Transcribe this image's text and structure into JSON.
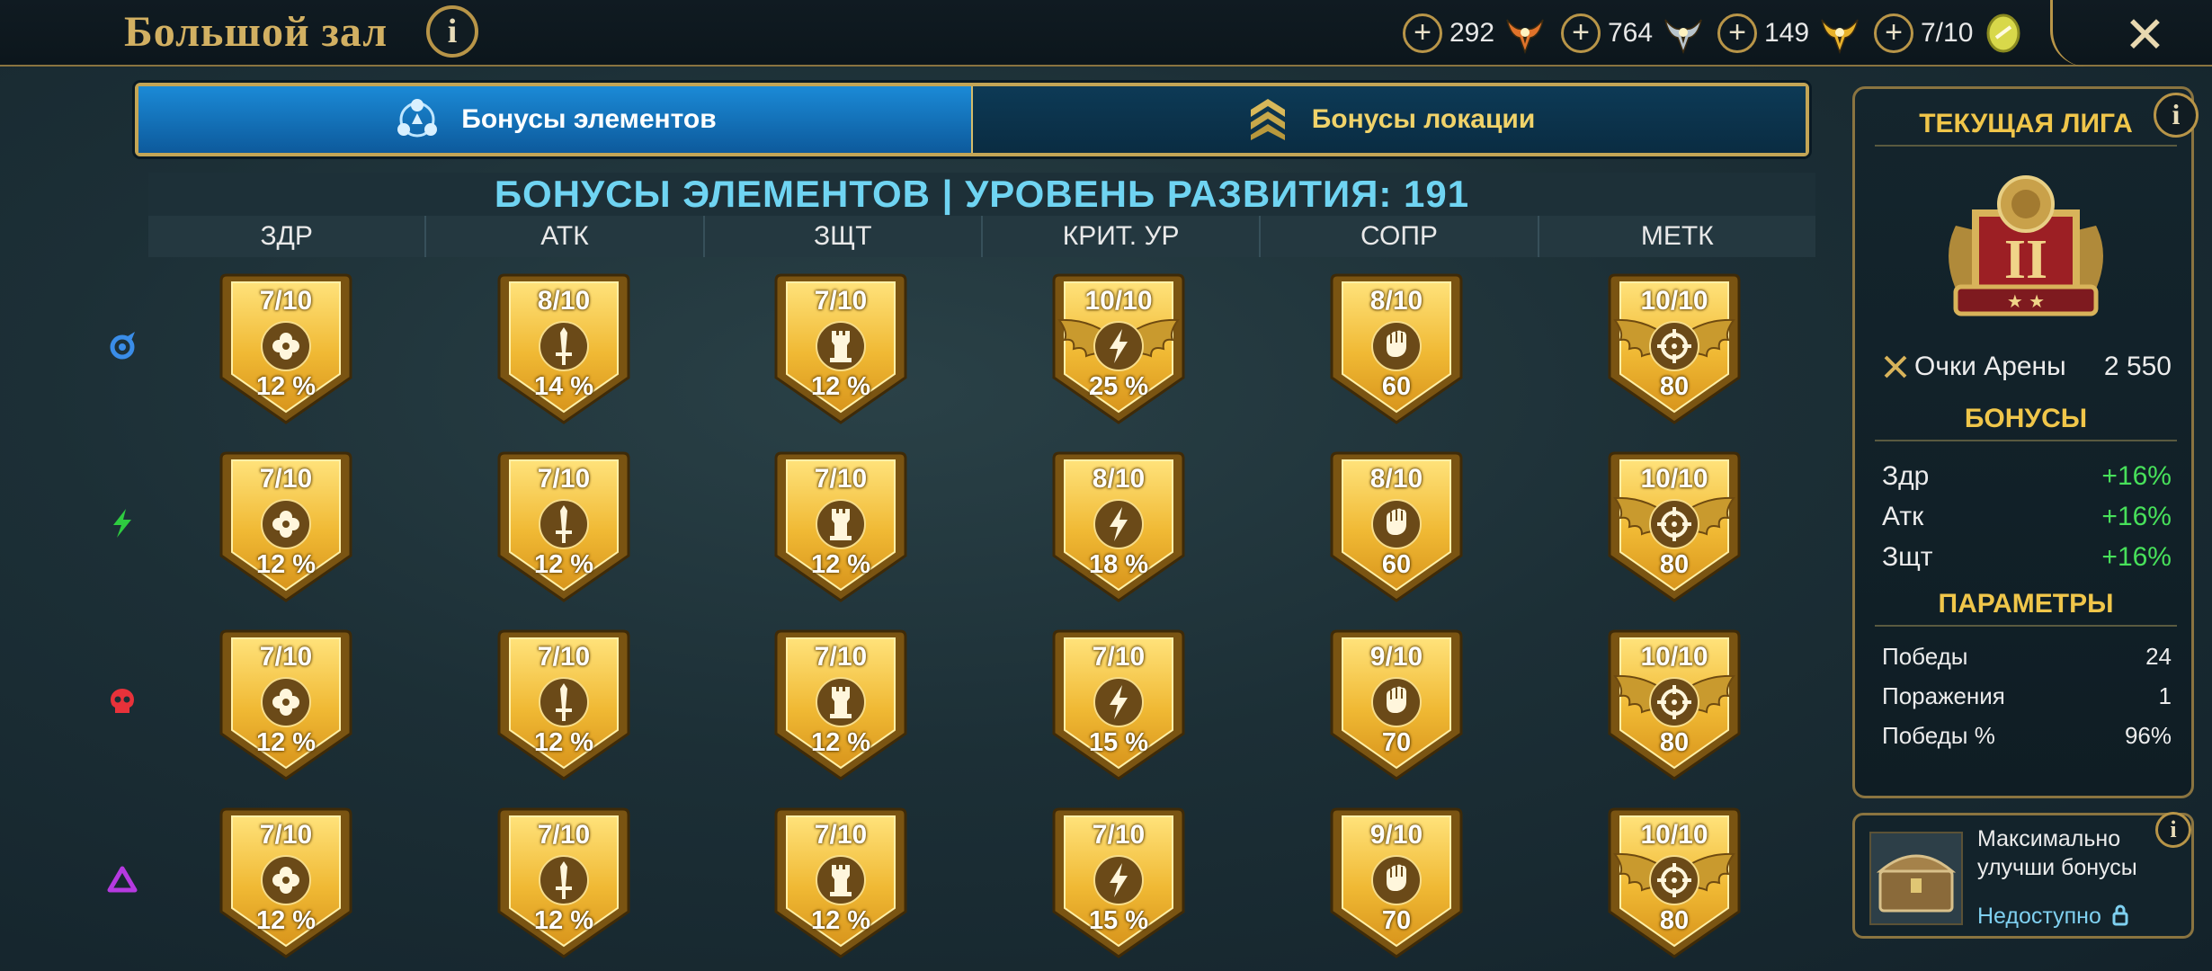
{
  "header": {
    "title": "Большой зал",
    "resources": [
      {
        "value": "292",
        "icon": "orange-wings-token-icon",
        "color": "#e0722a"
      },
      {
        "value": "764",
        "icon": "silver-wings-token-icon",
        "color": "#b8c4cc"
      },
      {
        "value": "149",
        "icon": "gold-wings-token-icon",
        "color": "#e8b22a"
      },
      {
        "value": "7/10",
        "icon": "arena-coin-icon",
        "color": "#d8d84a"
      }
    ]
  },
  "tabs": [
    {
      "label": "Бонусы элементов",
      "icon": "elements-icon",
      "active": true
    },
    {
      "label": "Бонусы локации",
      "icon": "location-chevrons-icon",
      "active": false
    }
  ],
  "grid": {
    "heading": "БОНУСЫ ЭЛЕМЕНТОВ | УРОВЕНЬ РАЗВИТИЯ: 191",
    "columns": [
      "ЗДР",
      "АТК",
      "ЗЩТ",
      "КРИТ. УР",
      "СОПР",
      "МЕТК"
    ],
    "column_icons": [
      "health-cross-icon",
      "sword-icon",
      "tower-shield-icon",
      "lightning-icon",
      "fist-icon",
      "crosshair-icon"
    ],
    "rows": [
      {
        "affinity": "magic",
        "icon": "magic-affinity-icon",
        "color": "#3a8de8",
        "cells": [
          {
            "level": "7/10",
            "value": "12 %",
            "winged": false
          },
          {
            "level": "8/10",
            "value": "14 %",
            "winged": false
          },
          {
            "level": "7/10",
            "value": "12 %",
            "winged": false
          },
          {
            "level": "10/10",
            "value": "25 %",
            "winged": true
          },
          {
            "level": "8/10",
            "value": "60",
            "winged": false
          },
          {
            "level": "10/10",
            "value": "80",
            "winged": true
          }
        ]
      },
      {
        "affinity": "force",
        "icon": "force-affinity-icon",
        "color": "#2ecc40",
        "cells": [
          {
            "level": "7/10",
            "value": "12 %",
            "winged": false
          },
          {
            "level": "7/10",
            "value": "12 %",
            "winged": false
          },
          {
            "level": "7/10",
            "value": "12 %",
            "winged": false
          },
          {
            "level": "8/10",
            "value": "18 %",
            "winged": false
          },
          {
            "level": "8/10",
            "value": "60",
            "winged": false
          },
          {
            "level": "10/10",
            "value": "80",
            "winged": true
          }
        ]
      },
      {
        "affinity": "void",
        "icon": "skull-affinity-icon",
        "color": "#e8323a",
        "cells": [
          {
            "level": "7/10",
            "value": "12 %",
            "winged": false
          },
          {
            "level": "7/10",
            "value": "12 %",
            "winged": false
          },
          {
            "level": "7/10",
            "value": "12 %",
            "winged": false
          },
          {
            "level": "7/10",
            "value": "15 %",
            "winged": false
          },
          {
            "level": "9/10",
            "value": "70",
            "winged": false
          },
          {
            "level": "10/10",
            "value": "80",
            "winged": true
          }
        ]
      },
      {
        "affinity": "spirit",
        "icon": "triangle-affinity-icon",
        "color": "#b63ae0",
        "cells": [
          {
            "level": "7/10",
            "value": "12 %",
            "winged": false
          },
          {
            "level": "7/10",
            "value": "12 %",
            "winged": false
          },
          {
            "level": "7/10",
            "value": "12 %",
            "winged": false
          },
          {
            "level": "7/10",
            "value": "15 %",
            "winged": false
          },
          {
            "level": "9/10",
            "value": "70",
            "winged": false
          },
          {
            "level": "10/10",
            "value": "80",
            "winged": true
          }
        ]
      }
    ]
  },
  "league": {
    "title": "ТЕКУЩАЯ ЛИГА",
    "rank_emblem": "league-emblem-II",
    "rank_numeral": "II",
    "arena_points_label": "Очки Арены",
    "arena_points": "2 550",
    "bonuses_title": "БОНУСЫ",
    "bonuses": [
      {
        "label": "Здр",
        "value": "+16%"
      },
      {
        "label": "Атк",
        "value": "+16%"
      },
      {
        "label": "Зщт",
        "value": "+16%"
      }
    ],
    "params_title": "ПАРАМЕТРЫ",
    "params": [
      {
        "label": "Победы",
        "value": "24"
      },
      {
        "label": "Поражения",
        "value": "1"
      },
      {
        "label": "Победы %",
        "value": "96%"
      }
    ]
  },
  "upgrade": {
    "text": "Максимально улучши бонусы",
    "status": "Недоступно"
  },
  "info_glyph": "i",
  "plus_glyph": "+",
  "close_glyph": "✕"
}
